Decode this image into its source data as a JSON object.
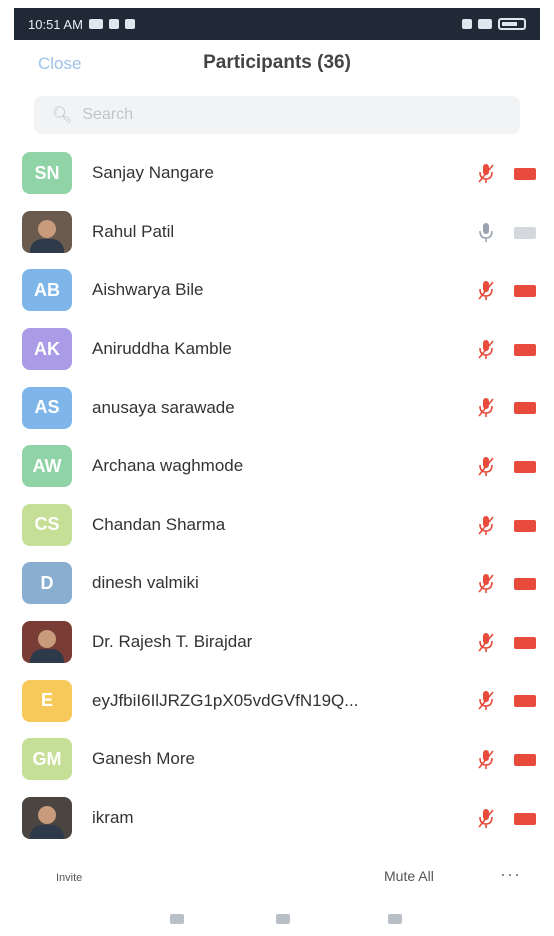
{
  "status_bar": {
    "time": "10:51 AM"
  },
  "header": {
    "close_label": "Close",
    "title": "Participants (36)"
  },
  "search": {
    "placeholder": "Search"
  },
  "participants": [
    {
      "initials": "SN",
      "name": "Sanjay Nangare",
      "avatar_color": "#8fd3a6",
      "photo": false,
      "mic": "muted",
      "video": "off"
    },
    {
      "initials": "",
      "name": "Rahul Patil",
      "avatar_color": "#6b5a4e",
      "photo": true,
      "mic": "active",
      "video": "gray"
    },
    {
      "initials": "AB",
      "name": "Aishwarya Bile",
      "avatar_color": "#7fb6ea",
      "photo": false,
      "mic": "muted",
      "video": "off"
    },
    {
      "initials": "AK",
      "name": "Aniruddha Kamble",
      "avatar_color": "#a99be6",
      "photo": false,
      "mic": "muted",
      "video": "off"
    },
    {
      "initials": "AS",
      "name": "anusaya sarawade",
      "avatar_color": "#7fb6ea",
      "photo": false,
      "mic": "muted",
      "video": "off"
    },
    {
      "initials": "AW",
      "name": "Archana waghmode",
      "avatar_color": "#8fd3a6",
      "photo": false,
      "mic": "muted",
      "video": "off"
    },
    {
      "initials": "CS",
      "name": "Chandan Sharma",
      "avatar_color": "#c6df96",
      "photo": false,
      "mic": "muted",
      "video": "off"
    },
    {
      "initials": "D",
      "name": "dinesh valmiki",
      "avatar_color": "#8aaed0",
      "photo": false,
      "mic": "muted",
      "video": "off"
    },
    {
      "initials": "",
      "name": "Dr. Rajesh T. Birajdar",
      "avatar_color": "#7a3d36",
      "photo": true,
      "mic": "muted",
      "video": "off"
    },
    {
      "initials": "E",
      "name": "eyJfbiI6IlJRZG1pX05vdGVfN19Q...",
      "avatar_color": "#f7c85a",
      "photo": false,
      "mic": "muted",
      "video": "off"
    },
    {
      "initials": "GM",
      "name": "Ganesh More",
      "avatar_color": "#c6df96",
      "photo": false,
      "mic": "muted",
      "video": "off"
    },
    {
      "initials": "",
      "name": "ikram",
      "avatar_color": "#4a4540",
      "photo": true,
      "mic": "muted",
      "video": "off"
    }
  ],
  "bottom": {
    "invite_label": "Invite",
    "mute_all_label": "Mute All",
    "more_label": "···"
  },
  "colors": {
    "muted_red": "#e84a3c",
    "active_gray": "#9aa3ad"
  }
}
